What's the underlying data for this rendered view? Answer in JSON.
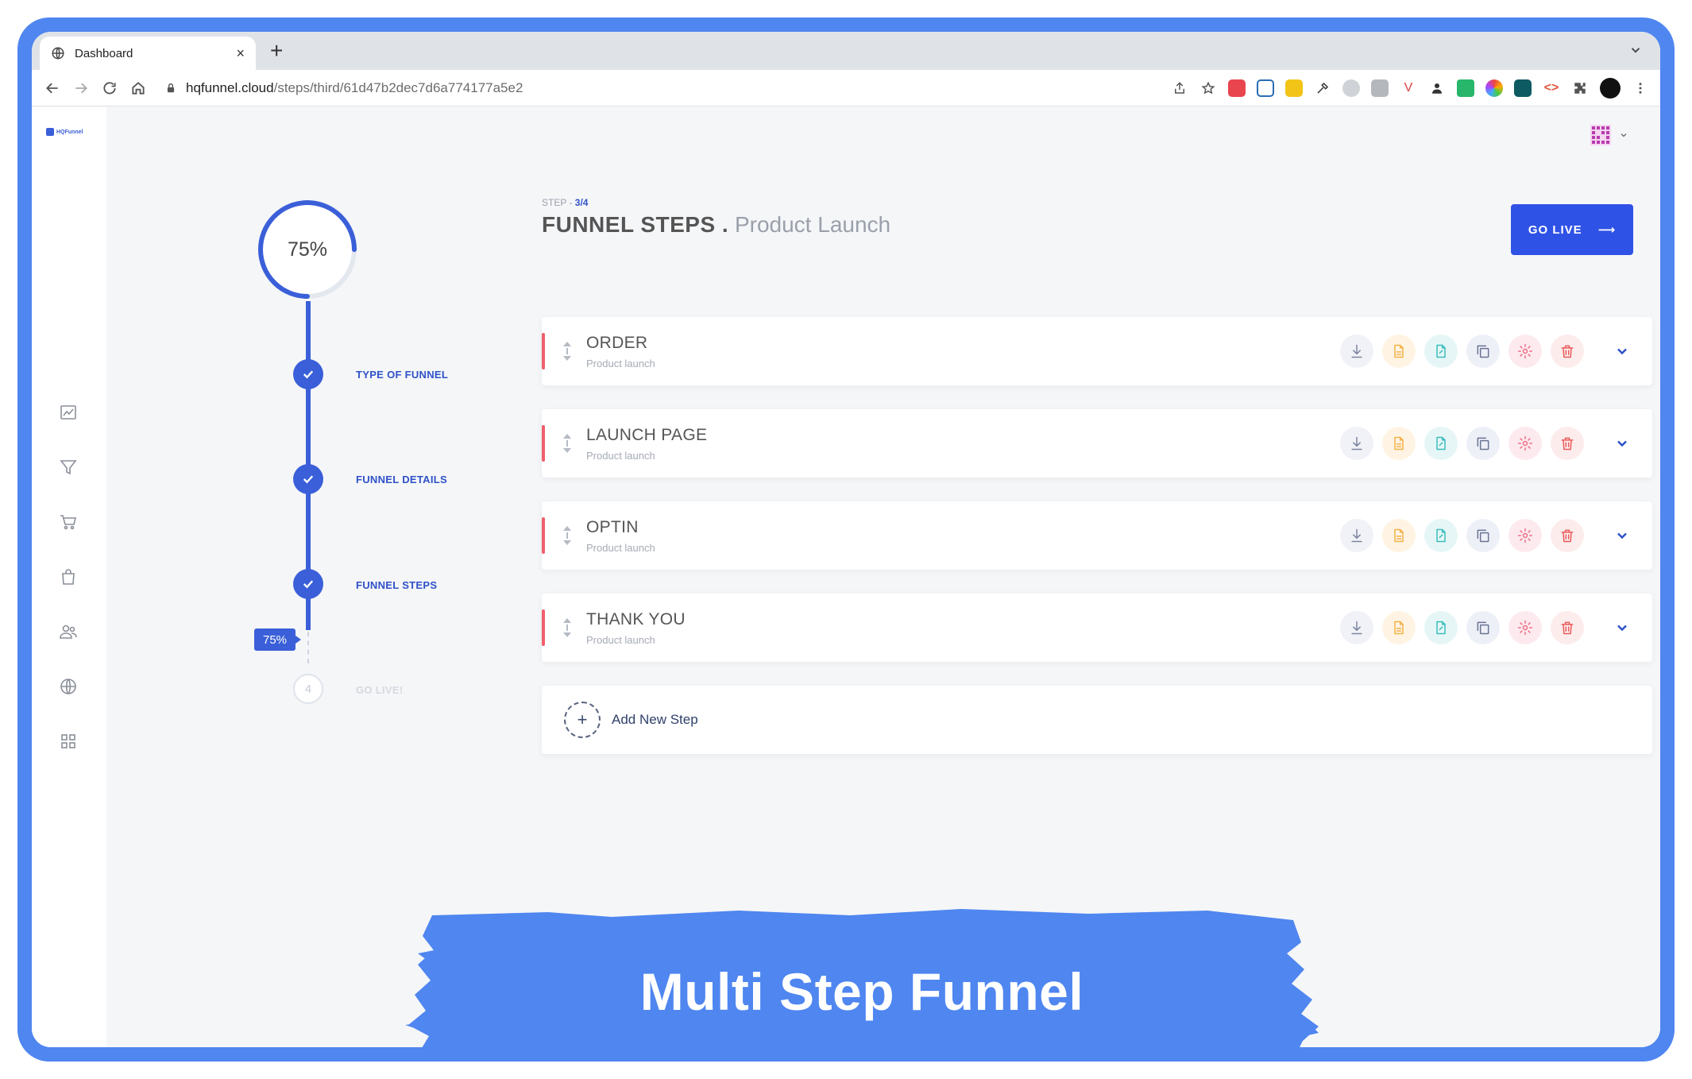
{
  "browser": {
    "tab_title": "Dashboard",
    "new_tab": "+",
    "url_host": "hqfunnel.cloud",
    "url_path": "/steps/third/61d47b2dec7d6a774177a5e2"
  },
  "app": {
    "logo_text": "HQFunnel"
  },
  "progress": {
    "percent_label": "75%",
    "percent_value": 75,
    "badge": "75%",
    "steps": [
      {
        "label": "TYPE OF FUNNEL",
        "done": true
      },
      {
        "label": "FUNNEL DETAILS",
        "done": true
      },
      {
        "label": "FUNNEL STEPS",
        "done": true
      },
      {
        "label": "GO LIVE!",
        "number": "4",
        "done": false
      }
    ]
  },
  "header": {
    "step_prefix": "STEP - ",
    "step_value": "3/4",
    "title": "FUNNEL STEPS .",
    "subtitle": "Product Launch",
    "go_live": "GO LIVE",
    "go_live_arrow": "⟶"
  },
  "funnel_steps": [
    {
      "title": "ORDER",
      "subtitle": "Product launch"
    },
    {
      "title": "LAUNCH PAGE",
      "subtitle": "Product launch"
    },
    {
      "title": "OPTIN",
      "subtitle": "Product launch"
    },
    {
      "title": "THANK YOU",
      "subtitle": "Product launch"
    }
  ],
  "add_step": {
    "label": "Add New Step",
    "icon": "+"
  },
  "banner": {
    "text": "Multi Step Funnel"
  },
  "colors": {
    "frame": "#4f86f0",
    "primary": "#2f52e6",
    "step_accent": "#ef5f6d",
    "banner": "#4f86f0"
  }
}
